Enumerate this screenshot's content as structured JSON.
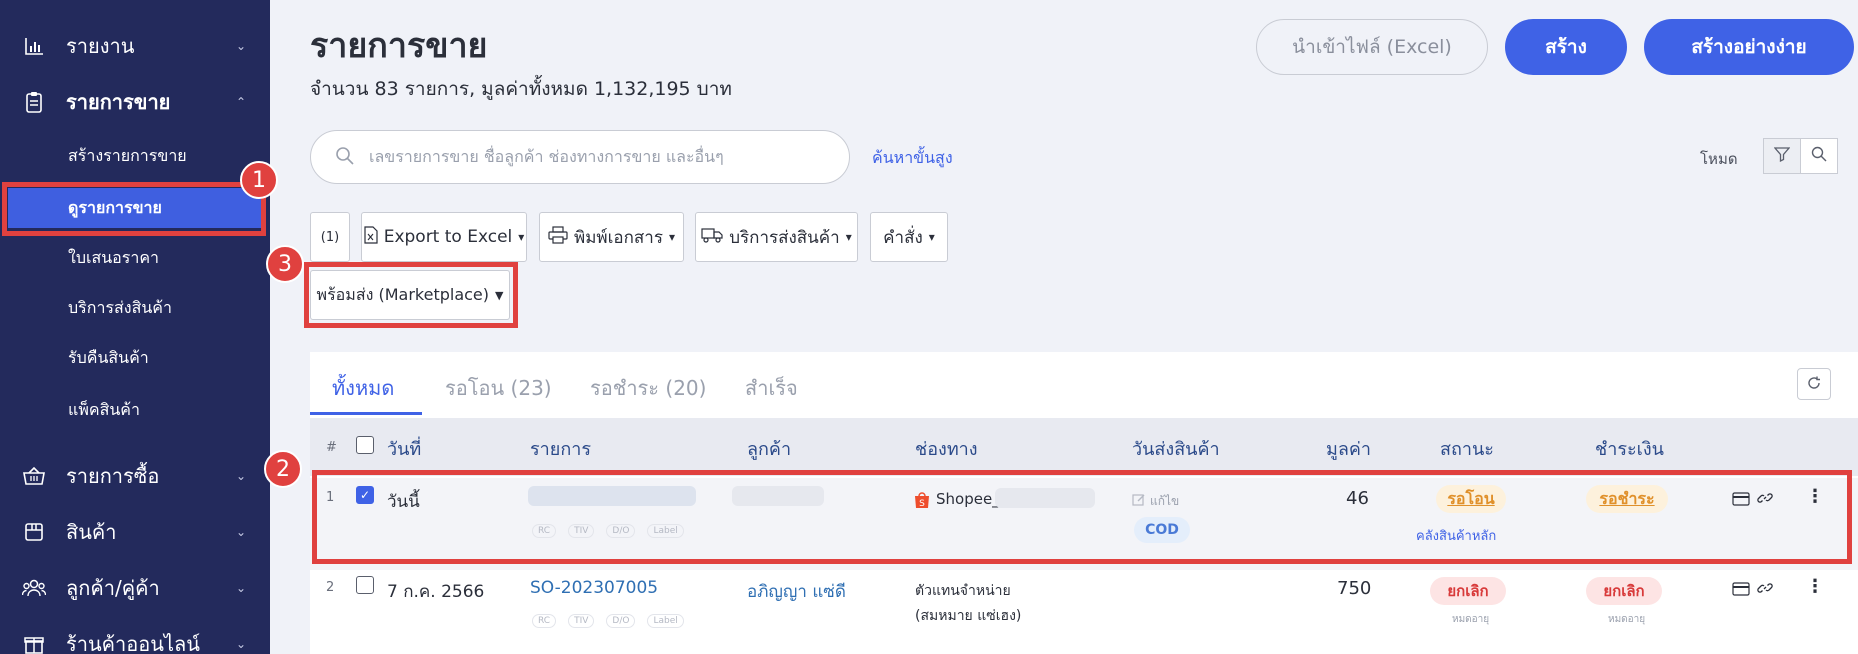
{
  "sidebar": {
    "report": "รายงาน",
    "sales": "รายการขาย",
    "sub": [
      "สร้างรายการขาย",
      "ดูรายการขาย",
      "ใบเสนอราคา",
      "บริการส่งสินค้า",
      "รับคืนสินค้า",
      "แพ็คสินค้า"
    ],
    "purchase": "รายการซื้อ",
    "products": "สินค้า",
    "customers": "ลูกค้า/คู่ค้า",
    "online": "ร้านค้าออนไลน์"
  },
  "header": {
    "title": "รายการขาย",
    "subtitle": "จำนวน 83 รายการ, มูลค่าทั้งหมด 1,132,195 บาท",
    "import_label": "นำเข้าไฟล์ (Excel)",
    "create_label": "สร้าง",
    "create_simple_label": "สร้างอย่างง่าย"
  },
  "search": {
    "placeholder": "เลขรายการขาย ชื่อลูกค้า ช่องทางการขาย และอื่นๆ",
    "advanced": "ค้นหาขั้นสูง",
    "mode": "โหมด"
  },
  "actions": {
    "count": "(1)",
    "export": "Export to Excel",
    "print": "พิมพ์เอกสาร",
    "shipping": "บริการส่งสินค้า",
    "command": "คำสั่ง",
    "ready": "พร้อมส่ง (Marketplace)"
  },
  "tabs": [
    "ทั้งหมด",
    "รอโอน (23)",
    "รอชำระ (20)",
    "สำเร็จ"
  ],
  "table": {
    "headers": {
      "num": "#",
      "date": "วันที่",
      "item": "รายการ",
      "customer": "ลูกค้า",
      "channel": "ช่องทาง",
      "ship": "วันส่งสินค้า",
      "value": "มูลค่า",
      "status": "สถานะ",
      "payment": "ชำระเงิน"
    },
    "tags": [
      "RC",
      "TIV",
      "D/O",
      "Label"
    ],
    "rows": [
      {
        "num": "1",
        "date": "วันนี้",
        "channel": "Shopee_",
        "edit": "แก้ไข",
        "cod": "COD",
        "value": "46",
        "status": "รอโอน",
        "warehouse": "คลังสินค้าหลัก",
        "payment": "รอชำระ"
      },
      {
        "num": "2",
        "date": "7 ก.ค. 2566",
        "item": "SO-202307005",
        "customer": "อภิญญา แซ่ดี",
        "channel1": "ตัวแทนจำหน่าย",
        "channel2": "(สมหมาย แซ่เฮง)",
        "value": "750",
        "status": "ยกเลิก",
        "status_note": "หมดอายุ",
        "payment": "ยกเลิก",
        "payment_note": "หมดอายุ"
      }
    ]
  },
  "annotations": [
    "1",
    "2",
    "3"
  ],
  "colors": {
    "sidebar": "#232a5c",
    "primary": "#3f62e6",
    "highlight": "#e0413f"
  }
}
